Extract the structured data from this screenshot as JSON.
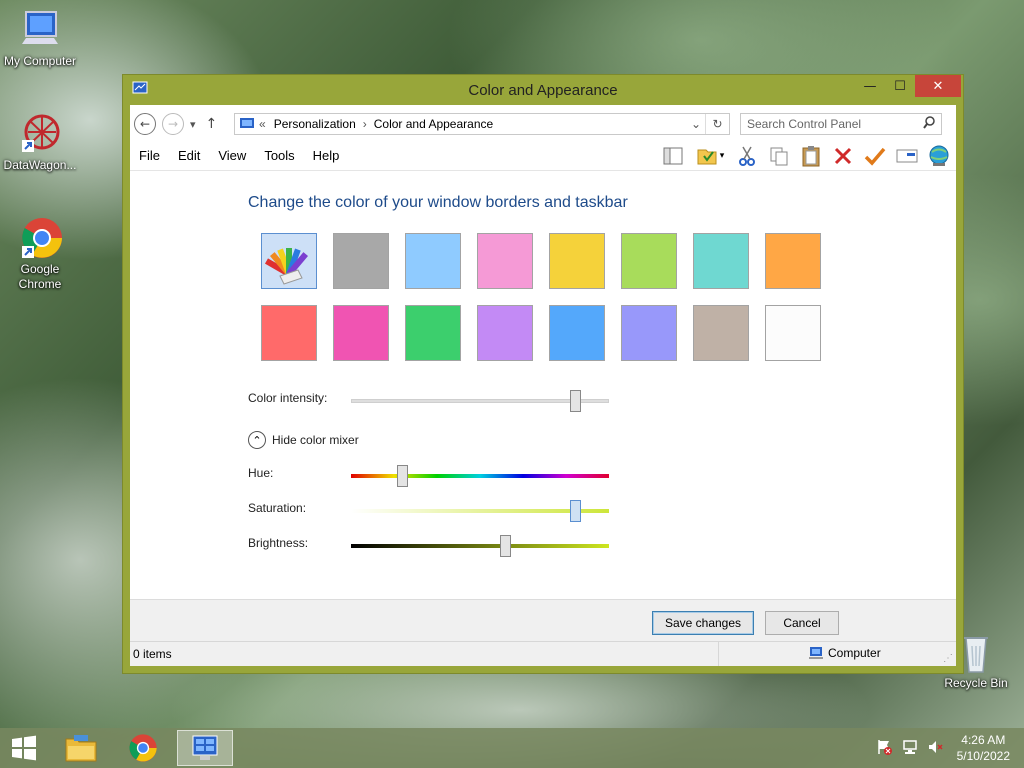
{
  "desktop": {
    "icons": [
      {
        "label": "My Computer"
      },
      {
        "label": "DataWagon..."
      },
      {
        "label": "Google Chrome"
      },
      {
        "label": "Recycle Bin"
      }
    ]
  },
  "window": {
    "title": "Color and Appearance",
    "controls": {
      "minimize": "—",
      "maximize": "☐",
      "close": "✕"
    },
    "nav": {
      "back": "←",
      "forward": "→",
      "dropdown": "▾",
      "up": "↑"
    },
    "address": {
      "prefix": "«",
      "crumbs": [
        "Personalization",
        "Color and Appearance"
      ],
      "separator": "›"
    },
    "search": {
      "placeholder": "Search Control Panel"
    },
    "menu": [
      "File",
      "Edit",
      "View",
      "Tools",
      "Help"
    ],
    "toolbar_icons": [
      "layout-icon",
      "properties-icon",
      "cut-icon",
      "copy-icon",
      "paste-icon",
      "delete-icon",
      "check-icon",
      "rename-icon",
      "globe-icon"
    ],
    "heading": "Change the color of your window borders and taskbar",
    "swatches": [
      {
        "color": "custom",
        "selected": true
      },
      {
        "color": "#a8a8a8"
      },
      {
        "color": "#8fcbff"
      },
      {
        "color": "#f59ad6"
      },
      {
        "color": "#f5d23a"
      },
      {
        "color": "#a8dc5b"
      },
      {
        "color": "#6fd8d1"
      },
      {
        "color": "#ffa745"
      },
      {
        "color": "#ff6a6a"
      },
      {
        "color": "#f054b2"
      },
      {
        "color": "#3ccf6d"
      },
      {
        "color": "#c38af5"
      },
      {
        "color": "#54a8fb"
      },
      {
        "color": "#9898fa"
      },
      {
        "color": "#bfb1a6"
      },
      {
        "color": "#fcfcfc"
      }
    ],
    "intensity": {
      "label": "Color intensity:",
      "value": 0.87
    },
    "mixer_toggle": {
      "icon": "⌃",
      "label": "Hide color mixer"
    },
    "hue": {
      "label": "Hue:",
      "value": 0.2
    },
    "saturation": {
      "label": "Saturation:",
      "value": 0.87
    },
    "brightness": {
      "label": "Brightness:",
      "value": 0.6
    },
    "buttons": {
      "save": "Save changes",
      "cancel": "Cancel"
    },
    "status": {
      "items": "0 items",
      "location": "Computer"
    }
  },
  "taskbar": {
    "clock": {
      "time": "4:26 AM",
      "date": "5/10/2022"
    }
  }
}
